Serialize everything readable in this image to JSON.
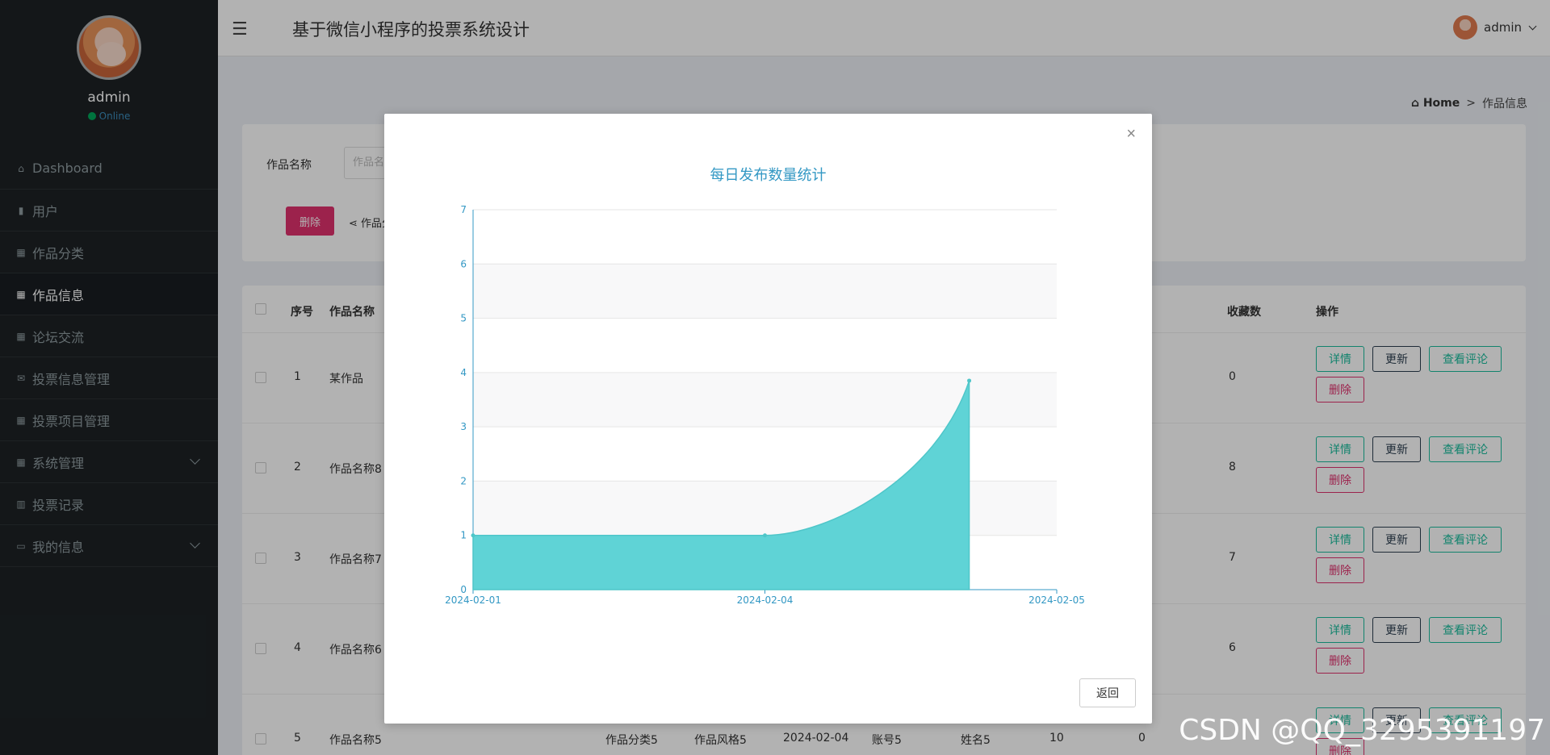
{
  "sidebar": {
    "user_name": "admin",
    "status": "Online",
    "items": [
      {
        "label": "Dashboard",
        "icon": "⌂"
      },
      {
        "label": "用户",
        "icon": "▮"
      },
      {
        "label": "作品分类",
        "icon": "▦"
      },
      {
        "label": "作品信息",
        "icon": "▦"
      },
      {
        "label": "论坛交流",
        "icon": "▦"
      },
      {
        "label": "投票信息管理",
        "icon": "✉"
      },
      {
        "label": "投票项目管理",
        "icon": "▦"
      },
      {
        "label": "系统管理",
        "icon": "▦"
      },
      {
        "label": "投票记录",
        "icon": "▥"
      },
      {
        "label": "我的信息",
        "icon": "▭"
      }
    ]
  },
  "header": {
    "title": "基于微信小程序的投票系统设计",
    "user": "admin",
    "menu_icon": "☰"
  },
  "breadcrumb": {
    "home": "Home",
    "sep": ">",
    "current": "作品信息"
  },
  "filter": {
    "label": "作品名称",
    "placeholder": "作品名称",
    "delete_btn": "删除",
    "category_btn": "作品分类"
  },
  "table": {
    "headers": {
      "seq": "序号",
      "name": "作品名称",
      "fav": "收藏数",
      "ops": "操作"
    },
    "rows": [
      {
        "seq": "1",
        "name": "某作品",
        "fav": "0"
      },
      {
        "seq": "2",
        "name": "作品名称8",
        "fav": "8"
      },
      {
        "seq": "3",
        "name": "作品名称7",
        "fav": "7"
      },
      {
        "seq": "4",
        "name": "作品名称6",
        "fav": "6"
      },
      {
        "seq": "5",
        "name": "作品名称5",
        "fav": "",
        "category": "作品分类5",
        "style": "作品风格5",
        "date": "2024-02-04",
        "account": "账号5",
        "username": "姓名5",
        "votes": "10",
        "extra": "0"
      }
    ],
    "ops": {
      "detail": "详情",
      "update": "更新",
      "comment": "查看评论",
      "delete": "删除"
    }
  },
  "modal": {
    "close": "×",
    "back_btn": "返回"
  },
  "chart_data": {
    "type": "area",
    "title": "每日发布数量统计",
    "x": [
      "2024-02-01",
      "2024-02-04",
      "2024-02-05"
    ],
    "series": [
      {
        "values": [
          1,
          1,
          3.85
        ],
        "color": "#5fd3d6"
      }
    ],
    "ylim": [
      0,
      7
    ],
    "yticks": [
      0,
      1,
      2,
      3,
      4,
      5,
      6,
      7
    ],
    "grid": true
  },
  "watermark": "CSDN @QQ_3295391197"
}
